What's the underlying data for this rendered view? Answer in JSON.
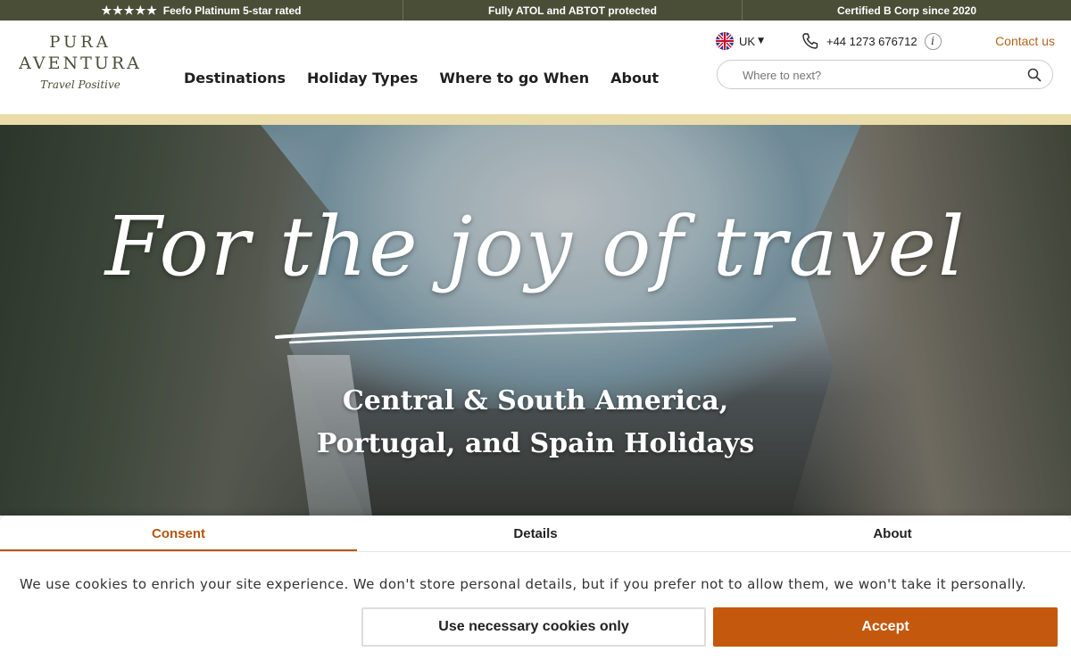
{
  "topbar": {
    "rating": {
      "stars": "★★★★★",
      "label": "Feefo Platinum 5-star rated"
    },
    "atol": "Fully ATOL and ABTOT protected",
    "bcorp": "Certified B Corp since 2020"
  },
  "logo": {
    "line1": "PURA",
    "line2": "AVENTURA",
    "tagline": "Travel Positive"
  },
  "nav": {
    "items": [
      "Destinations",
      "Holiday Types",
      "Where to go When",
      "About"
    ]
  },
  "util": {
    "region": "UK",
    "phone": "+44 1273 676712",
    "info": "i",
    "contact": "Contact us"
  },
  "search": {
    "placeholder": "Where to next?"
  },
  "hero": {
    "headline": "For the joy of travel",
    "subtitle_line1": "Central & South America,",
    "subtitle_line2": "Portugal, and Spain Holidays"
  },
  "consent": {
    "tabs": [
      "Consent",
      "Details",
      "About"
    ],
    "active_tab": "Consent",
    "message": "We use cookies to enrich your site experience. We don't store personal details, but if you prefer not to allow them, we won't take it personally.",
    "necessary_label": "Use necessary cookies only",
    "accept_label": "Accept"
  },
  "colors": {
    "topbar": "#4a4e37",
    "accent": "#b5651d",
    "accept": "#c4580c"
  }
}
